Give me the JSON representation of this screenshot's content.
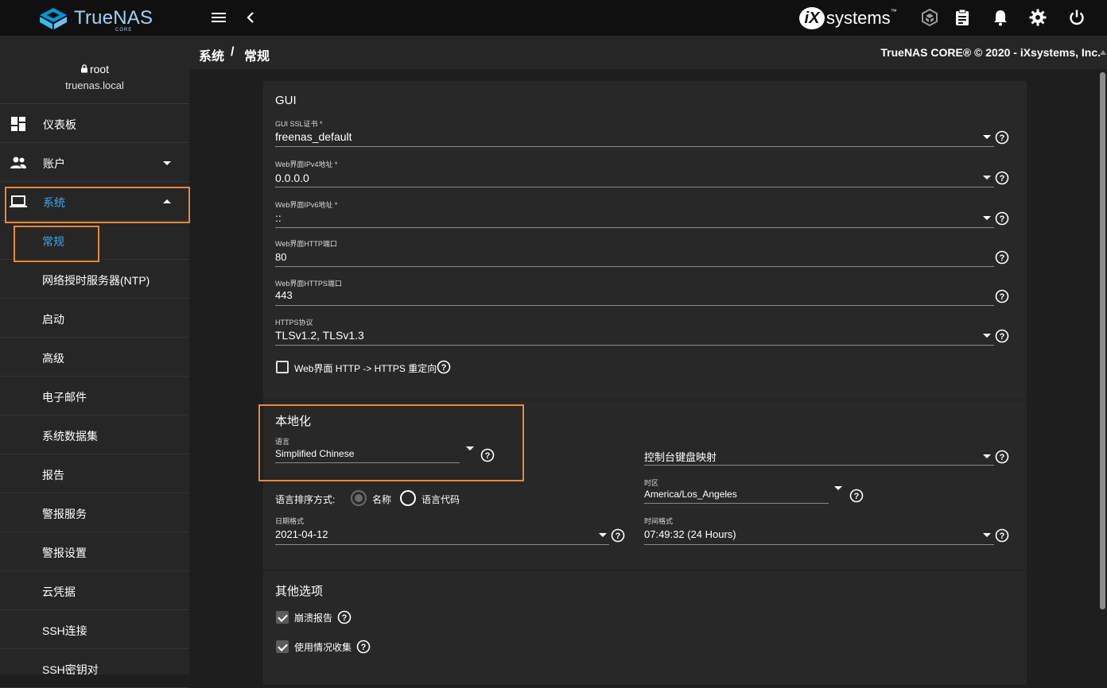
{
  "colors": {
    "accent": "#3fa8ea",
    "highlight": "#e8883a",
    "topbar_bg": "#101010",
    "sidebar_bg": "#262626",
    "card_bg": "#282828"
  },
  "topbar": {
    "logo_text": "TrueNAS",
    "logo_sub": "CORE",
    "menu_icon": "menu-icon",
    "back_icon": "chevron-left-icon",
    "vendor_logo_mark": "iX",
    "vendor_logo_text": "systems",
    "vendor_logo_tm": "™",
    "actions": [
      "truecommand-icon",
      "task-manager-icon",
      "notifications-icon",
      "settings-icon",
      "power-icon"
    ]
  },
  "sidebar": {
    "user": {
      "icon": "lock-icon",
      "name": "root",
      "host": "truenas.local"
    },
    "items": [
      {
        "label": "仪表板",
        "icon": "dashboard-icon"
      },
      {
        "label": "账户",
        "icon": "people-icon",
        "caret": "expand-more-icon"
      },
      {
        "label": "系统",
        "icon": "laptop-icon",
        "caret": "expand-less-icon"
      }
    ],
    "sub_items": [
      "常规",
      "网络授时服务器(NTP)",
      "启动",
      "高级",
      "电子邮件",
      "系统数据集",
      "报告",
      "警报服务",
      "警报设置",
      "云凭据",
      "SSH连接",
      "SSH密钥对"
    ]
  },
  "breadcrumb": {
    "parent": "系统",
    "separator": "/",
    "current": "常规",
    "copyright": "TrueNAS CORE® © 2020 - iXsystems, Inc."
  },
  "gui": {
    "title": "GUI",
    "ssl_cert": {
      "label": "GUI SSL证书 *",
      "value": "freenas_default"
    },
    "ipv4": {
      "label": "Web界面IPv4地址 *",
      "value": "0.0.0.0"
    },
    "ipv6": {
      "label": "Web界面IPv6地址 *",
      "value": "::"
    },
    "http_port": {
      "label": "Web界面HTTP端口",
      "value": "80"
    },
    "https_port": {
      "label": "Web界面HTTPS端口",
      "value": "443"
    },
    "https_protocols": {
      "label": "HTTPS协议",
      "value": "TLSv1.2, TLSv1.3"
    },
    "redirect": {
      "label": "Web界面 HTTP -> HTTPS 重定向",
      "checked": false
    }
  },
  "localization": {
    "title": "本地化",
    "language": {
      "label": "语言",
      "value": "Simplified Chinese"
    },
    "console_keymap": {
      "label": "控制台键盘映射",
      "value": ""
    },
    "sort_label": "语言排序方式:",
    "sort_options": [
      {
        "label": "名称",
        "selected": true,
        "disabled": true
      },
      {
        "label": "语言代码",
        "selected": false,
        "disabled": false
      }
    ],
    "timezone": {
      "label": "时区",
      "value": "America/Los_Angeles"
    },
    "date_format": {
      "label": "日期格式",
      "value": "2021-04-12"
    },
    "time_format": {
      "label": "时间格式",
      "value": "07:49:32 (24 Hours)"
    }
  },
  "other": {
    "title": "其他选项",
    "crash_reporting": {
      "label": "崩溃报告",
      "checked": true
    },
    "usage_collection": {
      "label": "使用情况收集",
      "checked": true
    }
  }
}
